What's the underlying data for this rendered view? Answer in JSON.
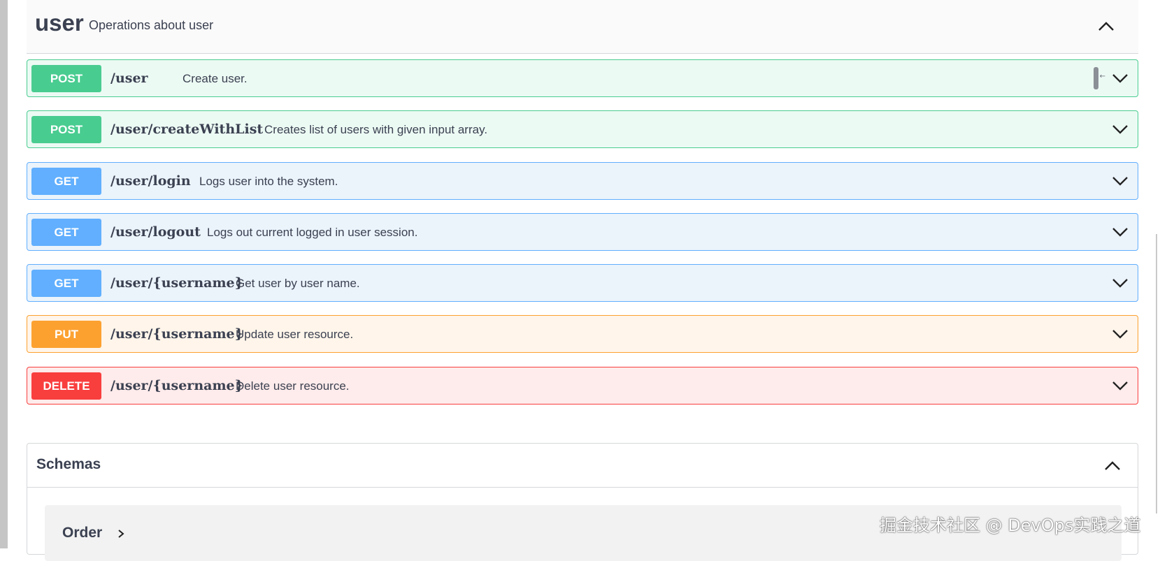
{
  "tag": {
    "name": "user",
    "description": "Operations about user"
  },
  "operations": [
    {
      "method": "POST",
      "path": "/user",
      "summary": "Create user."
    },
    {
      "method": "POST",
      "path": "/user/createWithList",
      "summary": "Creates list of users with given input array."
    },
    {
      "method": "GET",
      "path": "/user/login",
      "summary": "Logs user into the system."
    },
    {
      "method": "GET",
      "path": "/user/logout",
      "summary": "Logs out current logged in user session."
    },
    {
      "method": "GET",
      "path": "/user/{username}",
      "summary": "Get user by user name."
    },
    {
      "method": "PUT",
      "path": "/user/{username}",
      "summary": "Update user resource."
    },
    {
      "method": "DELETE",
      "path": "/user/{username}",
      "summary": "Delete user resource."
    }
  ],
  "schemas": {
    "title": "Schemas",
    "models": [
      "Order"
    ]
  },
  "watermark": "掘金技术社区 @ DevOps实践之道",
  "colors": {
    "post": "#49cc90",
    "get": "#61affe",
    "put": "#fca130",
    "delete": "#f93e3e"
  }
}
